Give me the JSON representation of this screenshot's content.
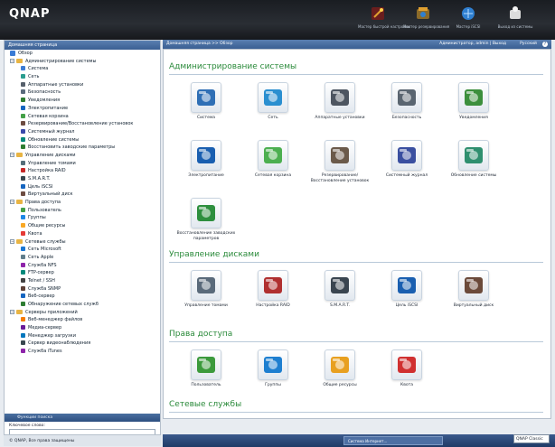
{
  "brand": {
    "logo": "QNAP"
  },
  "toolbar": [
    {
      "label": "Мастер быстрой настройки",
      "icon": "wizard-icon",
      "color": "#c0392b"
    },
    {
      "label": "Мастер резервирования",
      "icon": "backup-wizard-icon",
      "color": "#e0a030"
    },
    {
      "label": "Мастер iSCSI",
      "icon": "iscsi-wizard-icon",
      "color": "#2f7fd0"
    },
    {
      "label": "Выход из системы",
      "icon": "logout-icon",
      "color": "#dcdcdc"
    }
  ],
  "sidebar": {
    "header": "Домашняя страница",
    "items": [
      {
        "label": "Обзор",
        "level": 0,
        "type": "leaf",
        "color": "#3a7bd5"
      },
      {
        "label": "Администрирование системы",
        "level": 0,
        "type": "folder"
      },
      {
        "label": "Система",
        "level": 1,
        "color": "#3a7bd5"
      },
      {
        "label": "Сеть",
        "level": 1,
        "color": "#2a9d8f"
      },
      {
        "label": "Аппаратные установки",
        "level": 1,
        "color": "#555f6b"
      },
      {
        "label": "Безопасность",
        "level": 1,
        "color": "#5a6b7c"
      },
      {
        "label": "Уведомления",
        "level": 1,
        "color": "#2e7d32"
      },
      {
        "label": "Электропитание",
        "level": 1,
        "color": "#1565c0"
      },
      {
        "label": "Сетевая корзина",
        "level": 1,
        "color": "#43a047"
      },
      {
        "label": "Резервирование/Восстановление установок",
        "level": 1,
        "color": "#6d4c41"
      },
      {
        "label": "Системный журнал",
        "level": 1,
        "color": "#3949ab"
      },
      {
        "label": "Обновление системы",
        "level": 1,
        "color": "#00897b"
      },
      {
        "label": "Восстановить заводские параметры",
        "level": 1,
        "color": "#2e7d32"
      },
      {
        "label": "Управление дисками",
        "level": 0,
        "type": "folder"
      },
      {
        "label": "Управление томами",
        "level": 1,
        "color": "#546e7a"
      },
      {
        "label": "Настройка RAID",
        "level": 1,
        "color": "#c62828"
      },
      {
        "label": "S.M.A.R.T.",
        "level": 1,
        "color": "#37474f"
      },
      {
        "label": "Цель iSCSI",
        "level": 1,
        "color": "#1565c0"
      },
      {
        "label": "Виртуальный диск",
        "level": 1,
        "color": "#6d4c41"
      },
      {
        "label": "Права доступа",
        "level": 0,
        "type": "folder"
      },
      {
        "label": "Пользователь",
        "level": 1,
        "color": "#43a047"
      },
      {
        "label": "Группы",
        "level": 1,
        "color": "#1e88e5"
      },
      {
        "label": "Общие ресурсы",
        "level": 1,
        "color": "#f9a825"
      },
      {
        "label": "Квота",
        "level": 1,
        "color": "#e53935"
      },
      {
        "label": "Сетевые службы",
        "level": 0,
        "type": "folder"
      },
      {
        "label": "Сеть Microsoft",
        "level": 1,
        "color": "#1976d2"
      },
      {
        "label": "Сеть Apple",
        "level": 1,
        "color": "#607d8b"
      },
      {
        "label": "Служба NFS",
        "level": 1,
        "color": "#8e24aa"
      },
      {
        "label": "FTP-сервер",
        "level": 1,
        "color": "#00897b"
      },
      {
        "label": "Telnet / SSH",
        "level": 1,
        "color": "#424242"
      },
      {
        "label": "Служба SNMP",
        "level": 1,
        "color": "#5d4037"
      },
      {
        "label": "Веб-сервер",
        "level": 1,
        "color": "#1565c0"
      },
      {
        "label": "Обнаружение сетевых служб",
        "level": 1,
        "color": "#2e7d32"
      },
      {
        "label": "Серверы приложений",
        "level": 0,
        "type": "folder"
      },
      {
        "label": "Веб-менеджер файлов",
        "level": 1,
        "color": "#f57c00"
      },
      {
        "label": "Медиа-сервер",
        "level": 1,
        "color": "#6a1b9a"
      },
      {
        "label": "Менеджер загрузки",
        "level": 1,
        "color": "#0277bd"
      },
      {
        "label": "Сервер видеонаблюдения",
        "level": 1,
        "color": "#37474f"
      },
      {
        "label": "Служба iTunes",
        "level": 1,
        "color": "#8e24aa"
      }
    ],
    "function_search_label": "Функции поиска",
    "keyword_label": "Ключевое слово:",
    "footer": "© QNAP, Все права защищены"
  },
  "topbar": {
    "breadcrumb": "Домашняя страница >> Обзор",
    "user": "Администратор, admin | Выход",
    "language": "Русский"
  },
  "sections": [
    {
      "title": "Администрирование системы",
      "items": [
        {
          "label": "Система",
          "icon": "system-icon",
          "color": "#2f6fb5"
        },
        {
          "label": "Сеть",
          "icon": "network-globe-icon",
          "color": "#2a8fd0"
        },
        {
          "label": "Аппаратные установки",
          "icon": "hardware-icon",
          "color": "#4d5560"
        },
        {
          "label": "Безопасность",
          "icon": "security-icon",
          "color": "#5a6570"
        },
        {
          "label": "Уведомления",
          "icon": "notification-icon",
          "color": "#3c8f3c"
        },
        {
          "label": "Электропитание",
          "icon": "power-icon",
          "color": "#1a5fb0"
        },
        {
          "label": "Сетевая корзина",
          "icon": "recycle-bin-icon",
          "color": "#4caf50"
        },
        {
          "label": "Резервирование/Восстановление установок",
          "icon": "backup-restore-icon",
          "color": "#6b5a4a"
        },
        {
          "label": "Системный журнал",
          "icon": "system-log-icon",
          "color": "#3a4fa0"
        },
        {
          "label": "Обновление системы",
          "icon": "system-update-icon",
          "color": "#2f8f6f"
        },
        {
          "label": "Восстановление заводских параметров",
          "icon": "factory-reset-icon",
          "color": "#2e8f3e"
        }
      ]
    },
    {
      "title": "Управление дисками",
      "items": [
        {
          "label": "Управление томами",
          "icon": "volume-management-icon",
          "color": "#5a6a7a"
        },
        {
          "label": "Настройка RAID",
          "icon": "raid-icon",
          "color": "#b03030"
        },
        {
          "label": "S.M.A.R.T.",
          "icon": "smart-disk-icon",
          "color": "#3a4550"
        },
        {
          "label": "Цель iSCSI",
          "icon": "iscsi-target-icon",
          "color": "#1a5fb0"
        },
        {
          "label": "Виртуальный диск",
          "icon": "virtual-disk-icon",
          "color": "#6b4a3a"
        }
      ]
    },
    {
      "title": "Права доступа",
      "items": [
        {
          "label": "Пользователь",
          "icon": "user-icon",
          "color": "#3c9a3c"
        },
        {
          "label": "Группы",
          "icon": "groups-icon",
          "color": "#1e7fd0"
        },
        {
          "label": "Общие ресурсы",
          "icon": "shared-folders-icon",
          "color": "#e8a020"
        },
        {
          "label": "Квота",
          "icon": "quota-icon",
          "color": "#d03030"
        }
      ]
    },
    {
      "title": "Сетевые службы",
      "items": []
    }
  ],
  "taskbar": {
    "task": "Система Интернет...",
    "qnap_selector": "QNAP Classic"
  }
}
